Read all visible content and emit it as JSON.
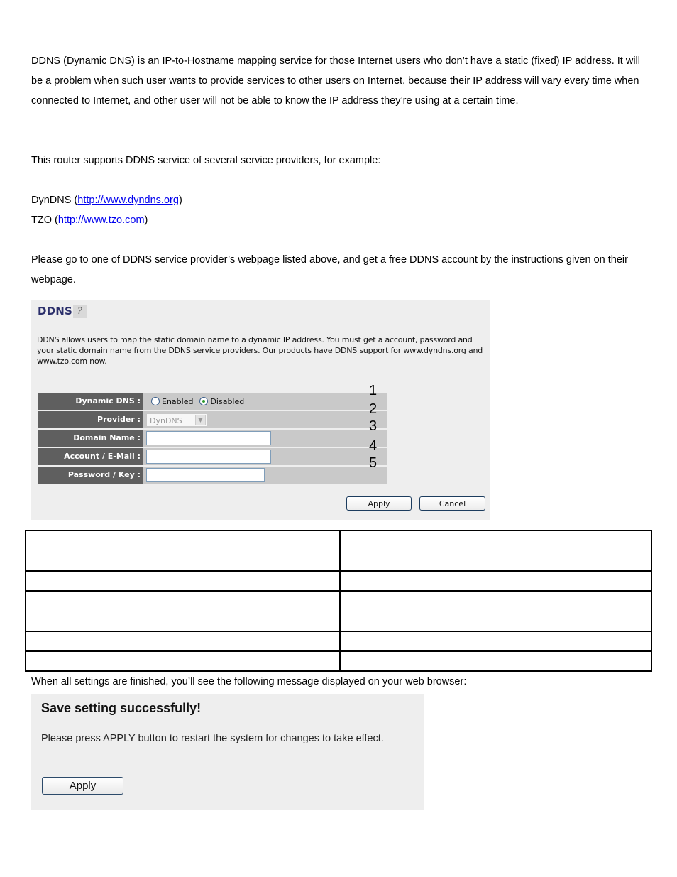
{
  "intro": {
    "paragraph1": "DDNS (Dynamic DNS) is an IP-to-Hostname mapping service for those Internet users who don’t have a static (fixed) IP address. It will be a problem when such user wants to provide services to other users on Internet, because their IP address will vary every time when connected to Internet, and other user will not be able to know the IP address they’re using at a certain time.",
    "paragraph2": "This router supports DDNS service of several service providers, for example:",
    "providers": [
      {
        "name": "DynDNS",
        "prefix": "DynDNS (",
        "link": "http://www.dyndns.org",
        "suffix": ")"
      },
      {
        "name": "TZO",
        "prefix": "TZO (",
        "link": "http://www.tzo.com",
        "suffix": ")"
      }
    ],
    "paragraph3": "Please go to one of DDNS service provider’s webpage listed above, and get a free DDNS account by the instructions given on their webpage."
  },
  "ddns_panel": {
    "title": "DDNS",
    "help_icon": "help-icon",
    "description": "DDNS allows users to map the static domain name to a dynamic IP address. You must get a account, password and your static domain name from the DDNS service providers. Our products have DDNS support for www.dyndns.org and www.tzo.com now.",
    "fields": {
      "dynamic_dns": {
        "label": "Dynamic DNS :",
        "options": [
          "Enabled",
          "Disabled"
        ],
        "selected": "Disabled"
      },
      "provider": {
        "label": "Provider :",
        "value": "DynDNS"
      },
      "domain_name": {
        "label": "Domain Name :",
        "value": ""
      },
      "account": {
        "label": "Account / E-Mail :",
        "value": ""
      },
      "password": {
        "label": "Password / Key :",
        "value": ""
      }
    },
    "callouts": [
      "1",
      "2",
      "3",
      "4",
      "5"
    ],
    "apply_label": "Apply",
    "cancel_label": "Cancel"
  },
  "table": {
    "rows": [
      [
        "",
        ""
      ],
      [
        "",
        ""
      ],
      [
        "",
        ""
      ],
      [
        "",
        ""
      ],
      [
        "",
        ""
      ]
    ]
  },
  "after_text": "When all settings are finished, you’ll see the following message displayed on your web browser:",
  "success_panel": {
    "title": "Save setting successfully!",
    "message": "Please press APPLY button to restart the system for changes to take effect.",
    "apply_label": "Apply"
  }
}
